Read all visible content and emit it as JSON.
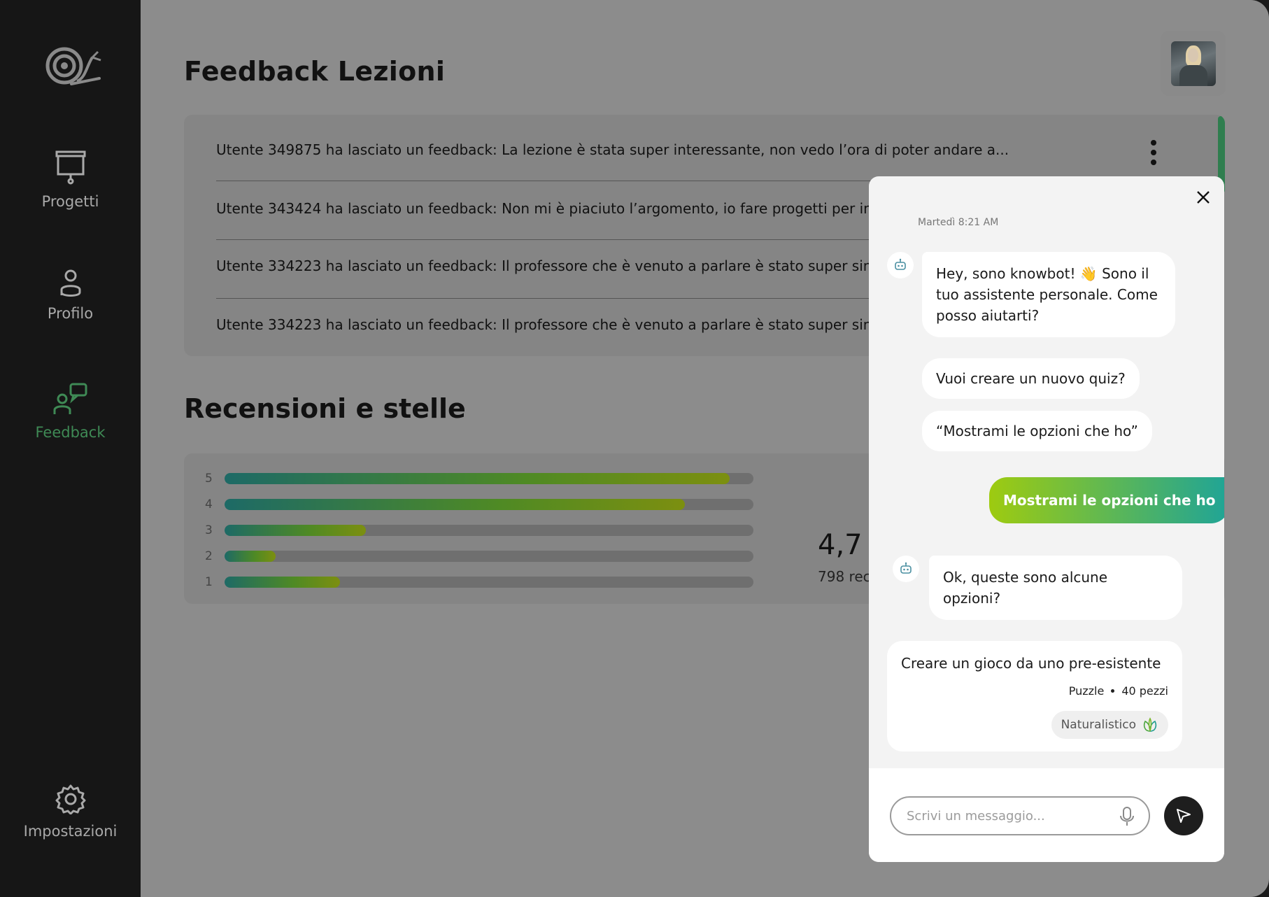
{
  "sidebar": {
    "items": [
      {
        "label": "Progetti",
        "icon": "presentation-board-icon"
      },
      {
        "label": "Profilo",
        "icon": "user-icon"
      },
      {
        "label": "Feedback",
        "icon": "feedback-chat-icon",
        "active": true
      },
      {
        "label": "Impostazioni",
        "icon": "gear-icon"
      }
    ]
  },
  "header": {
    "title": "Feedback Lezioni"
  },
  "feedback": {
    "rows": [
      "Utente 349875 ha lasciato un feedback: La lezione è stata super interessante, non vedo l’ora di poter andare a...",
      "Utente 343424 ha lasciato un feedback:  Non mi è piaciuto l’argomento, io fare progetti per in",
      "Utente 334223 ha lasciato un feedback:  Il professore che è venuto a parlare è stato super sin",
      "Utente 334223 ha lasciato un feedback:  Il professore che è venuto a parlare è stato super sin"
    ]
  },
  "ratings": {
    "title": "Recensioni e stelle",
    "rows": [
      {
        "label": "5",
        "fraction": 0.955
      },
      {
        "label": "4",
        "fraction": 0.87
      },
      {
        "label": "3",
        "fraction": 0.267
      },
      {
        "label": "2",
        "fraction": 0.097
      },
      {
        "label": "1",
        "fraction": 0.218
      }
    ],
    "average": "4,7",
    "count": "798 rec"
  },
  "chat": {
    "timestamp": "Martedì 8:21 AM",
    "bot_greeting": "Hey, sono knowbot! 👋 Sono il tuo assistente personale. Come posso aiutarti?",
    "suggestions": [
      "Vuoi creare un nuovo quiz?",
      "“Mostrami le opzioni che ho”"
    ],
    "user_message": "Mostrami le opzioni che ho",
    "bot_reply": "Ok, queste sono alcune opzioni?",
    "option": {
      "title": "Creare un gioco da uno pre-esistente",
      "type": "Puzzle",
      "pieces": "40 pezzi",
      "tag": "Naturalistico"
    },
    "input_placeholder": "Scrivi un messaggio...",
    "accent_gradient": [
      "#9ecb10",
      "#1fa497"
    ]
  },
  "colors": {
    "sidebar_active": "#3f8a55",
    "scrollbar": "#2f7e4f"
  }
}
